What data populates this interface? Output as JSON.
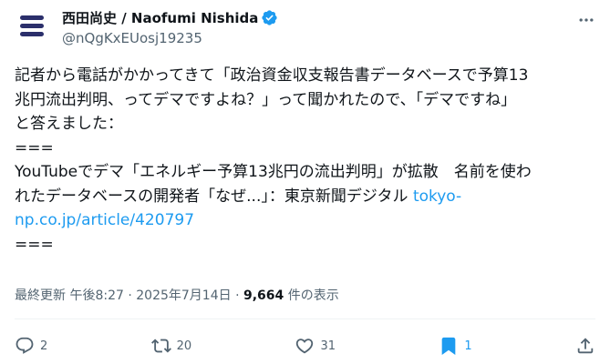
{
  "author": {
    "display_name": "西田尚史 / Naofumi Nishida",
    "handle": "@nQgKxEUosj19235",
    "verified": true
  },
  "tweet": {
    "lines": [
      "記者から電話がかかってきて「政治資金収支報告書データベースで予算13",
      "兆円流出判明、ってデマですよね？」って聞かれたので、「デマですね」",
      "と答えました：",
      "===",
      "YouTubeでデマ「エネルギー予算13兆円の流出判明」が拡散　名前を使わ",
      "れたデータベースの開発者「なぜ...」：東京新聞デジタル"
    ],
    "link_part1": "tokyo-",
    "link_part2": "np.co.jp/article/420797",
    "closing": "==="
  },
  "meta": {
    "prefix": "最終更新",
    "time": "午後8:27",
    "sep1": "·",
    "date": "2025年7月14日",
    "sep2": "·",
    "views": "9,664",
    "views_suffix": "件の表示"
  },
  "actions": {
    "reply_count": "2",
    "retweet_count": "20",
    "like_count": "31",
    "bookmark_count": "1"
  },
  "icons": {
    "verified": "verified-badge-icon",
    "more": "more-horizontal-icon",
    "reply": "reply-icon",
    "retweet": "retweet-icon",
    "like": "heart-icon",
    "bookmark": "bookmark-icon",
    "share": "share-icon"
  },
  "colors": {
    "text": "#0f1419",
    "secondary": "#536471",
    "link": "#1d9bf0",
    "bookmark_active": "#1d9bf0"
  }
}
